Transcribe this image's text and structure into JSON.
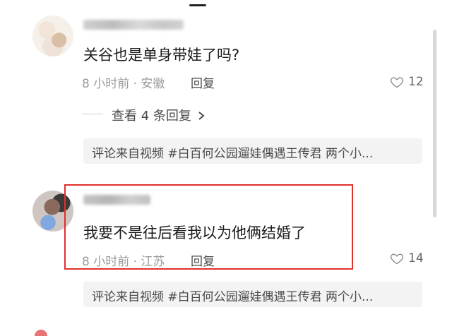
{
  "comments": [
    {
      "text": "关谷也是单身带娃了吗?",
      "meta": "8 小时前 · 安徽",
      "reply_label": "回复",
      "likes": "12",
      "view_replies": "查看 4 条回复",
      "source": "评论来自视频 #白百何公园遛娃偶遇王传君 两个小..."
    },
    {
      "text": "我要不是往后看我以为他俩结婚了",
      "meta": "8 小时前 · 江苏",
      "reply_label": "回复",
      "likes": "14",
      "source": "评论来自视频 #白百何公园遛娃偶遇王传君 两个小..."
    }
  ],
  "icons": {
    "like": "heart-outline-icon",
    "chevron": "chevron-right-icon"
  },
  "colors": {
    "highlight_border": "#e0302c",
    "source_bg": "#f3f3f3"
  }
}
